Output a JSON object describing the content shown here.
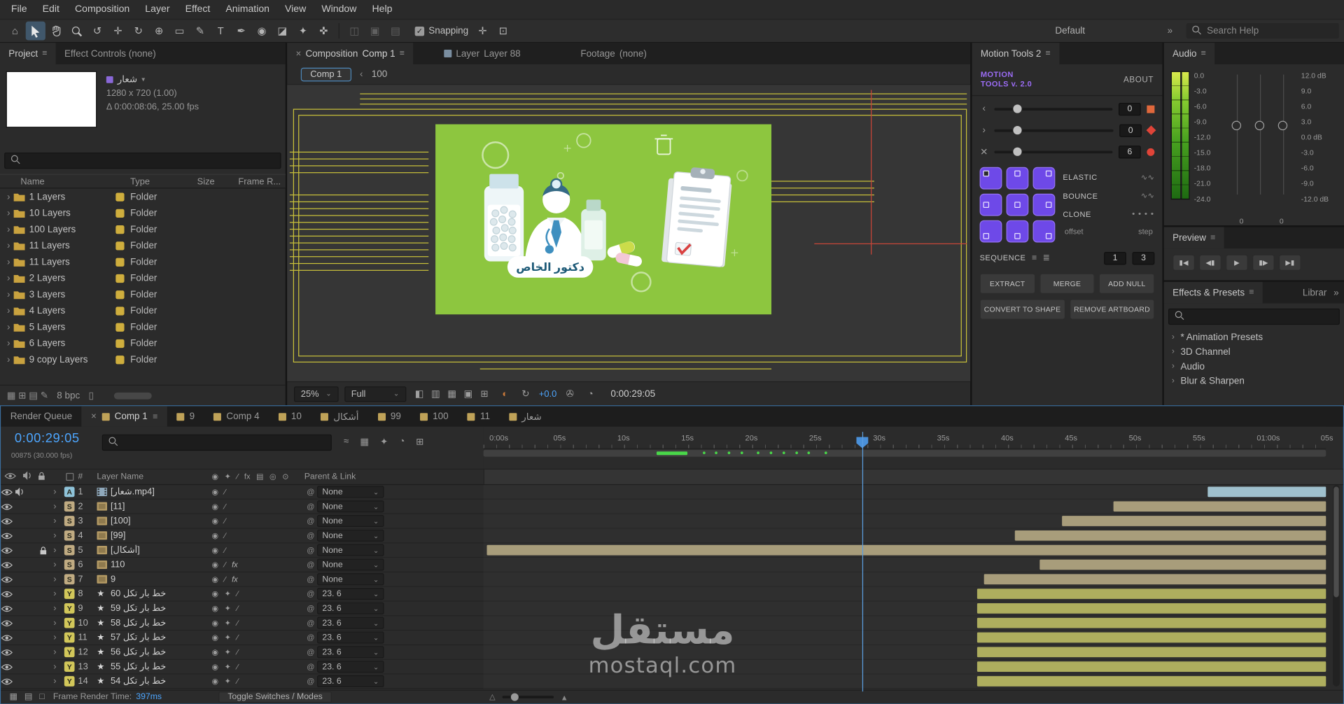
{
  "icons": {
    "menu": "≡",
    "close": "×",
    "caret": "⌄",
    "chevron_right": "›",
    "chevron_left": "‹",
    "star": "★",
    "fx_badge": "fx",
    "pickwhip": "@",
    "flag_caret": "▾",
    "wave": "∿∿",
    "clone_dots": "● ● ● ●",
    "quality": "◉",
    "collapse": "✦",
    "slash": "∕"
  },
  "menu": {
    "items": [
      "File",
      "Edit",
      "Composition",
      "Layer",
      "Effect",
      "Animation",
      "View",
      "Window",
      "Help"
    ]
  },
  "toolbar": {
    "tools": [
      {
        "name": "home-icon",
        "glyph": "⌂"
      },
      {
        "name": "selection-tool-icon",
        "svg": "cursor",
        "active": true
      },
      {
        "name": "hand-tool-icon",
        "svg": "hand"
      },
      {
        "name": "zoom-tool-icon",
        "svg": "zoom"
      },
      {
        "name": "orbit-camera-tool-icon",
        "glyph": "↺"
      },
      {
        "name": "pan-camera-tool-icon",
        "glyph": "✛"
      },
      {
        "name": "rotate-tool-icon",
        "glyph": "↻"
      },
      {
        "name": "pan-behind-tool-icon",
        "glyph": "⊕"
      },
      {
        "name": "shape-tool-icon",
        "glyph": "▭"
      },
      {
        "name": "pen-tool-icon",
        "glyph": "✎"
      },
      {
        "name": "type-tool-icon",
        "glyph": "T"
      },
      {
        "name": "brush-tool-icon",
        "glyph": "✒"
      },
      {
        "name": "clone-stamp-tool-icon",
        "glyph": "◉"
      },
      {
        "name": "eraser-tool-icon",
        "glyph": "◪"
      },
      {
        "name": "roto-brush-tool-icon",
        "glyph": "✦"
      },
      {
        "name": "puppet-pin-tool-icon",
        "glyph": "✜"
      }
    ],
    "dim_tools": [
      "◫",
      "▣",
      "▤"
    ],
    "snap_extra": [
      "✛",
      "⊡"
    ],
    "snapping_label": "Snapping",
    "workspace_label": "Default",
    "overflow_glyph": "»",
    "search_placeholder": "Search Help"
  },
  "project": {
    "tabs": {
      "project": "Project",
      "effect_controls": "Effect Controls (none)"
    },
    "comp_name": "شعار",
    "dims": "1280 x 720 (1.00)",
    "duration": "Δ 0:00:08:06, 25.00 fps",
    "columns": {
      "name": "Name",
      "type": "Type",
      "size": "Size",
      "frame_rate": "Frame R..."
    },
    "rows": [
      {
        "name": "1 Layers",
        "type": "Folder"
      },
      {
        "name": "10 Layers",
        "type": "Folder"
      },
      {
        "name": "100 Layers",
        "type": "Folder"
      },
      {
        "name": "11 Layers",
        "type": "Folder"
      },
      {
        "name": "11 Layers",
        "type": "Folder"
      },
      {
        "name": "2 Layers",
        "type": "Folder"
      },
      {
        "name": "3 Layers",
        "type": "Folder"
      },
      {
        "name": "4 Layers",
        "type": "Folder"
      },
      {
        "name": "5 Layers",
        "type": "Folder"
      },
      {
        "name": "6 Layers",
        "type": "Folder"
      },
      {
        "name": "9 copy Layers",
        "type": "Folder"
      }
    ],
    "bpc": "8 bpc"
  },
  "comp": {
    "tabs": {
      "composition": "Composition",
      "composition_name": "Comp 1",
      "layer": "Layer",
      "layer_name": "Layer 88",
      "footage": "Footage",
      "footage_name": "(none)"
    },
    "nav": {
      "current": "Comp 1",
      "parent": "100"
    },
    "banner_text": "دكتور الخاص",
    "zoom": "25%",
    "resolution": "Full",
    "exposure": "+0.0",
    "timecode": "0:00:29:05",
    "bottom_icons": [
      {
        "name": "region-of-interest-icon",
        "glyph": "◧"
      },
      {
        "name": "transparency-grid-icon",
        "glyph": "▥"
      },
      {
        "name": "mask-visibility-icon",
        "glyph": "▦"
      },
      {
        "name": "view-layout-icon",
        "glyph": "▣"
      },
      {
        "name": "grid-guides-icon",
        "glyph": "⊞"
      }
    ],
    "channel_icon": "◐",
    "reset_exposure_icon": "↻",
    "snapshot_icon": "✇",
    "show_snapshot_icon": "◔"
  },
  "motion_tools": {
    "title": "Motion Tools 2",
    "brand_line1": "MOTION",
    "brand_line2": "TOOLS v. 2.0",
    "about": "ABOUT",
    "sliders": [
      {
        "icon": "‹",
        "value": "0",
        "shape": "square"
      },
      {
        "icon": "›",
        "value": "0",
        "shape": "diamond"
      },
      {
        "icon": "✕",
        "value": "6",
        "shape": "circle"
      }
    ],
    "grid_positions": [
      "tl",
      "t",
      "tr",
      "l",
      "c",
      "r",
      "bl",
      "b",
      "br"
    ],
    "elastic": "ELASTIC",
    "bounce": "BOUNCE",
    "clone": "CLONE",
    "offset": "offset",
    "step": "step",
    "sequence": "SEQUENCE",
    "seq_values": [
      "1",
      "3"
    ],
    "buttons": [
      "EXTRACT",
      "MERGE",
      "ADD NULL"
    ],
    "buttons2": [
      "CONVERT TO SHAPE",
      "REMOVE ARTBOARD"
    ]
  },
  "audio": {
    "title": "Audio",
    "meter_scale": [
      "0.0",
      "-3.0",
      "-6.0",
      "-9.0",
      "-12.0",
      "-15.0",
      "-18.0",
      "-21.0",
      "-24.0"
    ],
    "fader_scale": [
      "12.0 dB",
      "9.0",
      "6.0",
      "3.0",
      "0.0 dB",
      "-3.0",
      "-6.0",
      "-9.0",
      "-12.0 dB"
    ],
    "bottom_values": [
      "0",
      "0"
    ]
  },
  "preview": {
    "title": "Preview",
    "buttons": [
      {
        "name": "first-frame-button",
        "glyph": "▮◀"
      },
      {
        "name": "previous-frame-button",
        "glyph": "◀▮"
      },
      {
        "name": "play-button",
        "glyph": "▶"
      },
      {
        "name": "next-frame-button",
        "glyph": "▮▶"
      },
      {
        "name": "last-frame-button",
        "glyph": "▶▮"
      }
    ]
  },
  "effects": {
    "title": "Effects & Presets",
    "libraries_tab": "Librar",
    "overflow": "»",
    "items": [
      "* Animation Presets",
      "3D Channel",
      "Audio",
      "Blur & Sharpen"
    ]
  },
  "timeline": {
    "tabs": [
      {
        "label": "Render Queue",
        "icon": false,
        "active": false
      },
      {
        "label": "Comp 1",
        "icon": true,
        "active": true
      },
      {
        "label": "9",
        "icon": true,
        "active": false
      },
      {
        "label": "Comp 4",
        "icon": true,
        "active": false
      },
      {
        "label": "10",
        "icon": true,
        "active": false
      },
      {
        "label": "أشكال",
        "icon": true,
        "active": false
      },
      {
        "label": "99",
        "icon": true,
        "active": false
      },
      {
        "label": "100",
        "icon": true,
        "active": false
      },
      {
        "label": "11",
        "icon": true,
        "active": false
      },
      {
        "label": "شعار",
        "icon": true,
        "active": false
      }
    ],
    "timecode": "0:00:29:05",
    "frame_info": "00875 (30.000 fps)",
    "head_icons": [
      "≈",
      "▦",
      "✦",
      "◔",
      "⊞"
    ],
    "ruler_labels": [
      "0:00s",
      "05s",
      "10s",
      "15s",
      "20s",
      "25s",
      "30s",
      "35s",
      "40s",
      "45s",
      "50s",
      "55s",
      "01:00s",
      "05s"
    ],
    "columns": {
      "hash": "#",
      "layer_name": "Layer Name",
      "parent": "Parent & Link"
    },
    "switch_header": [
      "◉",
      "✦",
      "∕",
      "fx",
      "▤",
      "◎",
      "⊙"
    ],
    "work_markers": {
      "solid_start": 20.6,
      "solid_width": 3.6,
      "dots": [
        26,
        27.5,
        29,
        30.5,
        32.5,
        34,
        35.5,
        37,
        38.5,
        40.5
      ]
    },
    "layers": [
      {
        "label": "A",
        "label_color": "#8fc3d9",
        "num": "1",
        "icon": "film",
        "name": "[شعار.mp4]",
        "audio": true,
        "locked": false,
        "fx": false,
        "star": false,
        "parent": "None",
        "bar_start": 86.0,
        "bar_color": "#9fc0cd"
      },
      {
        "label": "S",
        "label_color": "#c0ab82",
        "num": "2",
        "icon": "comp",
        "name": "[11]",
        "audio": false,
        "locked": false,
        "fx": false,
        "star": false,
        "parent": "None",
        "bar_start": 74.8,
        "bar_color": "#a89d7b"
      },
      {
        "label": "S",
        "label_color": "#c0ab82",
        "num": "3",
        "icon": "comp",
        "name": "[100]",
        "audio": false,
        "locked": false,
        "fx": false,
        "star": false,
        "parent": "None",
        "bar_start": 68.7,
        "bar_color": "#a89d7b"
      },
      {
        "label": "S",
        "label_color": "#c0ab82",
        "num": "4",
        "icon": "comp",
        "name": "[99]",
        "audio": false,
        "locked": false,
        "fx": false,
        "star": false,
        "parent": "None",
        "bar_start": 63.1,
        "bar_color": "#a89d7b"
      },
      {
        "label": "S",
        "label_color": "#c0ab82",
        "num": "5",
        "icon": "comp",
        "name": "[أشكال]",
        "audio": false,
        "locked": true,
        "fx": false,
        "star": false,
        "parent": "None",
        "bar_start": 0.4,
        "bar_color": "#a89d7b"
      },
      {
        "label": "S",
        "label_color": "#c0ab82",
        "num": "6",
        "icon": "comp",
        "name": "110",
        "audio": false,
        "locked": false,
        "fx": true,
        "star": false,
        "parent": "None",
        "bar_start": 66.0,
        "bar_color": "#a89d7b"
      },
      {
        "label": "S",
        "label_color": "#c0ab82",
        "num": "7",
        "icon": "comp",
        "name": "9",
        "audio": false,
        "locked": false,
        "fx": true,
        "star": false,
        "parent": "None",
        "bar_start": 59.4,
        "bar_color": "#a89d7b"
      },
      {
        "label": "Y",
        "label_color": "#d2c75a",
        "num": "8",
        "icon": "star",
        "name": "خط بار تكل 60",
        "audio": false,
        "locked": false,
        "fx": false,
        "star": true,
        "parent": "23. 6",
        "bar_start": 58.6,
        "bar_color": "#aeae5e"
      },
      {
        "label": "Y",
        "label_color": "#d2c75a",
        "num": "9",
        "icon": "star",
        "name": "خط بار تكل 59",
        "audio": false,
        "locked": false,
        "fx": false,
        "star": true,
        "parent": "23. 6",
        "bar_start": 58.6,
        "bar_color": "#aeae5e"
      },
      {
        "label": "Y",
        "label_color": "#d2c75a",
        "num": "10",
        "icon": "star",
        "name": "خط بار تكل 58",
        "audio": false,
        "locked": false,
        "fx": false,
        "star": true,
        "parent": "23. 6",
        "bar_start": 58.6,
        "bar_color": "#aeae5e"
      },
      {
        "label": "Y",
        "label_color": "#d2c75a",
        "num": "11",
        "icon": "star",
        "name": "خط بار تكل 57",
        "audio": false,
        "locked": false,
        "fx": false,
        "star": true,
        "parent": "23. 6",
        "bar_start": 58.6,
        "bar_color": "#aeae5e"
      },
      {
        "label": "Y",
        "label_color": "#d2c75a",
        "num": "12",
        "icon": "star",
        "name": "خط بار تكل 56",
        "audio": false,
        "locked": false,
        "fx": false,
        "star": true,
        "parent": "23. 6",
        "bar_start": 58.6,
        "bar_color": "#aeae5e"
      },
      {
        "label": "Y",
        "label_color": "#d2c75a",
        "num": "13",
        "icon": "star",
        "name": "خط بار تكل 55",
        "audio": false,
        "locked": false,
        "fx": false,
        "star": true,
        "parent": "23. 6",
        "bar_start": 58.6,
        "bar_color": "#aeae5e"
      },
      {
        "label": "Y",
        "label_color": "#d2c75a",
        "num": "14",
        "icon": "star",
        "name": "خط بار تكل 54",
        "audio": false,
        "locked": false,
        "fx": false,
        "star": true,
        "parent": "23. 6",
        "bar_start": 58.6,
        "bar_color": "#aeae5e"
      }
    ],
    "footer": {
      "icons": [
        "▦",
        "▤",
        "□"
      ],
      "label": "Frame Render Time:",
      "time": "397ms",
      "toggle": "Toggle Switches / Modes"
    }
  },
  "watermark": {
    "line1": "مستقل",
    "line2": "mostaql.com"
  }
}
